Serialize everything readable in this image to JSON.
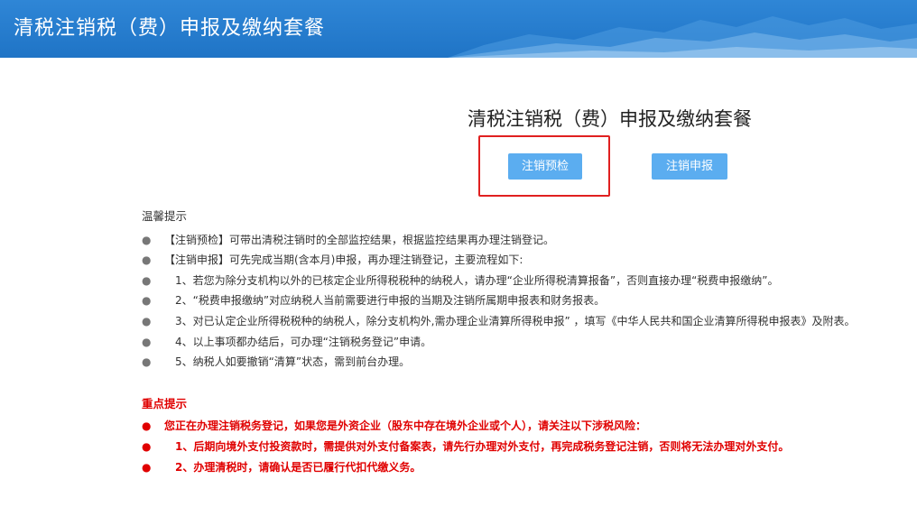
{
  "header": {
    "title": "清税注销税（费）申报及缴纳套餐"
  },
  "page": {
    "title": "清税注销税（费）申报及缴纳套餐"
  },
  "buttons": {
    "precheck": "注销预检",
    "declare": "注销申报"
  },
  "tips": {
    "title": "温馨提示",
    "items": [
      "【注销预检】可带出清税注销时的全部监控结果，根据监控结果再办理注销登记。",
      "【注销申报】可先完成当期(含本月)申报，再办理注销登记，主要流程如下:",
      "1、若您为除分支机构以外的已核定企业所得税税种的纳税人，请办理“企业所得税清算报备”，否则直接办理“税费申报缴纳”。",
      "2、“税费申报缴纳”对应纳税人当前需要进行申报的当期及注销所属期申报表和财务报表。",
      "3、对已认定企业所得税税种的纳税人，除分支机构外,需办理企业清算所得税申报” ，填写《中华人民共和国企业清算所得税申报表》及附表。",
      "4、以上事项都办结后，可办理“注销税务登记”申请。",
      "5、纳税人如要撤销“清算”状态，需到前台办理。"
    ]
  },
  "key_tips": {
    "title": "重点提示",
    "items": [
      "您正在办理注销税务登记，如果您是外资企业（股东中存在境外企业或个人），请关注以下涉税风险：",
      "1、后期向境外支付投资款时，需提供对外支付备案表，请先行办理对外支付，再完成税务登记注销，否则将无法办理对外支付。",
      "2、办理清税时，请确认是否已履行代扣代缴义务。"
    ]
  },
  "colors": {
    "header_bg": "#1f74c6",
    "button_bg": "#5badf0",
    "highlight_border": "#e02020",
    "key_text": "#e00000"
  }
}
